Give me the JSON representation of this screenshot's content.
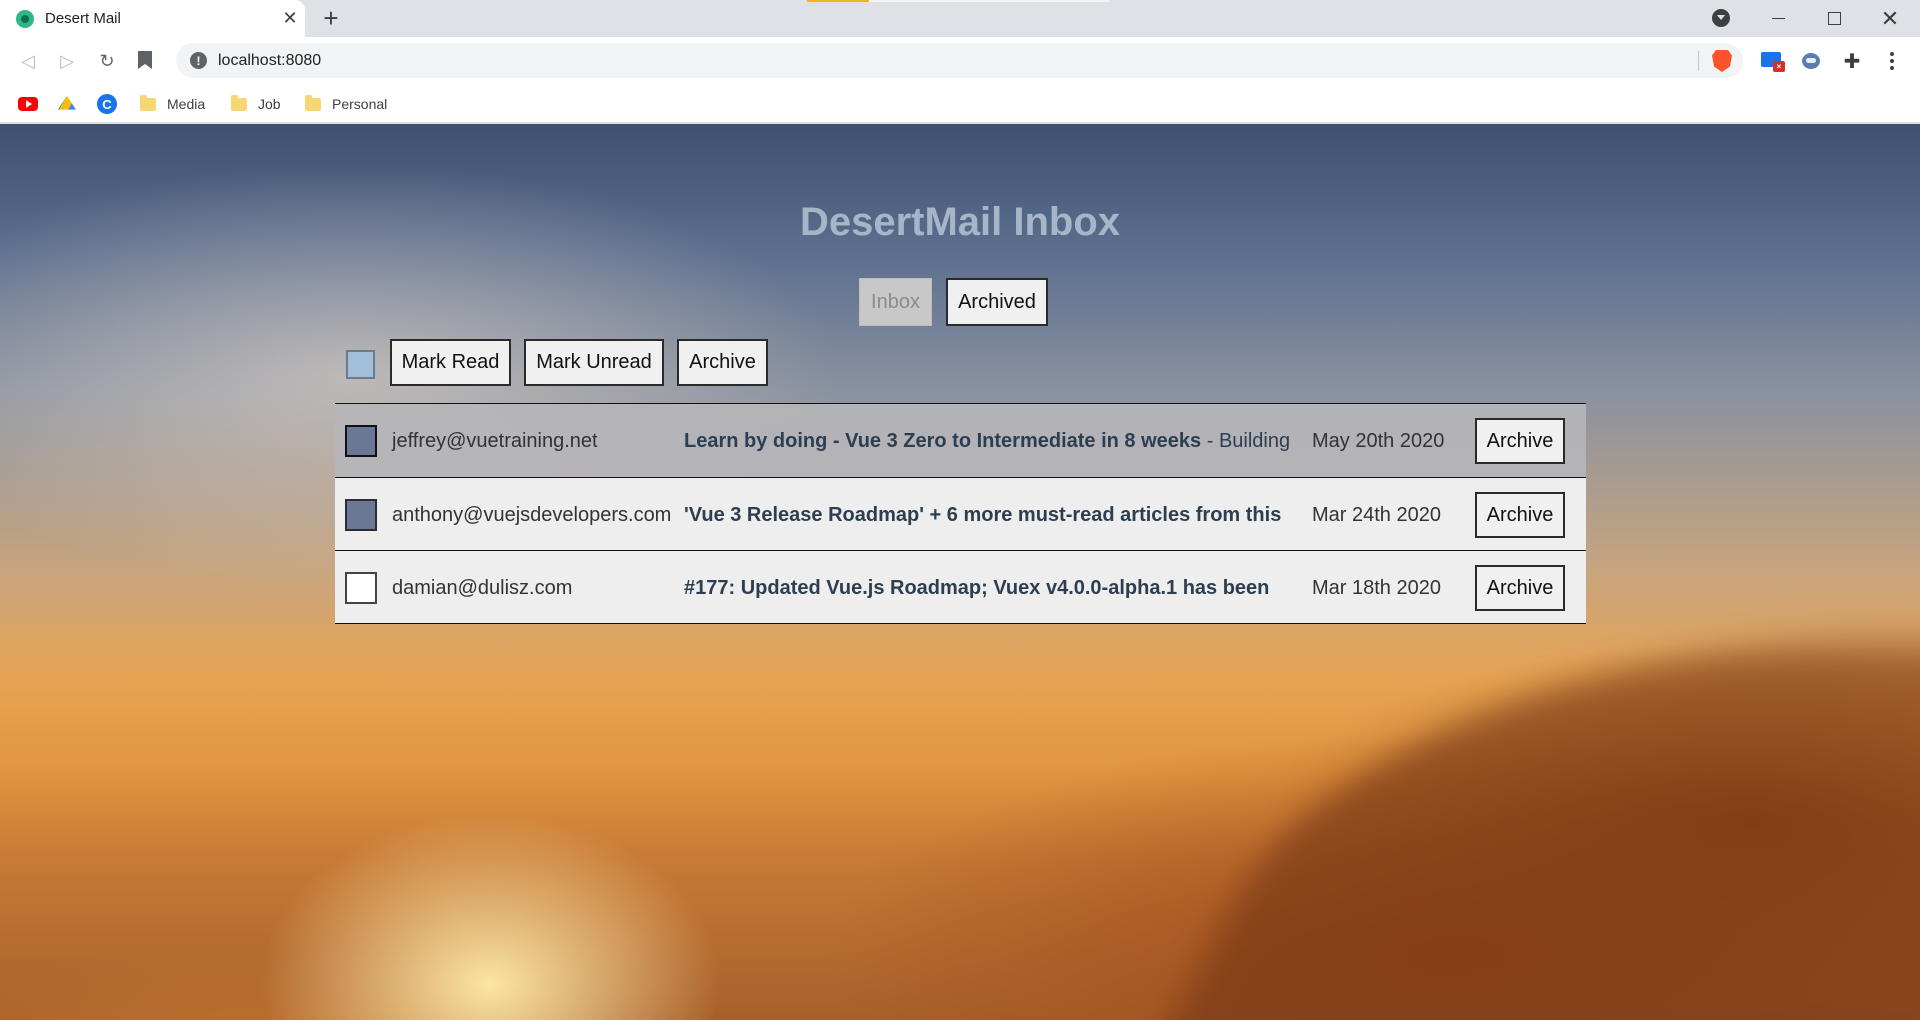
{
  "browser": {
    "tab_title": "Desert Mail",
    "url": "localhost:8080",
    "bookmarks": [
      "Media",
      "Job",
      "Personal"
    ]
  },
  "app": {
    "title": "DesertMail Inbox",
    "tabs": {
      "inbox": "Inbox",
      "archived": "Archived"
    },
    "bulk_actions": {
      "mark_read": "Mark Read",
      "mark_unread": "Mark Unread",
      "archive": "Archive"
    },
    "emails": [
      {
        "from": "jeffrey@vuetraining.net",
        "subject": "Learn by doing - Vue 3 Zero to Intermediate in 8 weeks",
        "preview": " - Building",
        "date": "May 20th 2020",
        "archive_label": "Archive",
        "read": true,
        "selected": true
      },
      {
        "from": "anthony@vuejsdevelopers.com",
        "subject": "'Vue 3 Release Roadmap' + 6 more must-read articles from this",
        "preview": "",
        "date": "Mar 24th 2020",
        "archive_label": "Archive",
        "read": false,
        "selected": true
      },
      {
        "from": "damian@dulisz.com",
        "subject": "#177: Updated Vue.js Roadmap; Vuex v4.0.0-alpha.1 has been",
        "preview": "",
        "date": "Mar 18th 2020",
        "archive_label": "Archive",
        "read": false,
        "selected": false
      }
    ]
  },
  "colors": {
    "title": "#a6b5c7",
    "checkbox_checked": "#6a7896",
    "bulk_checkbox": "#a3bed8"
  }
}
